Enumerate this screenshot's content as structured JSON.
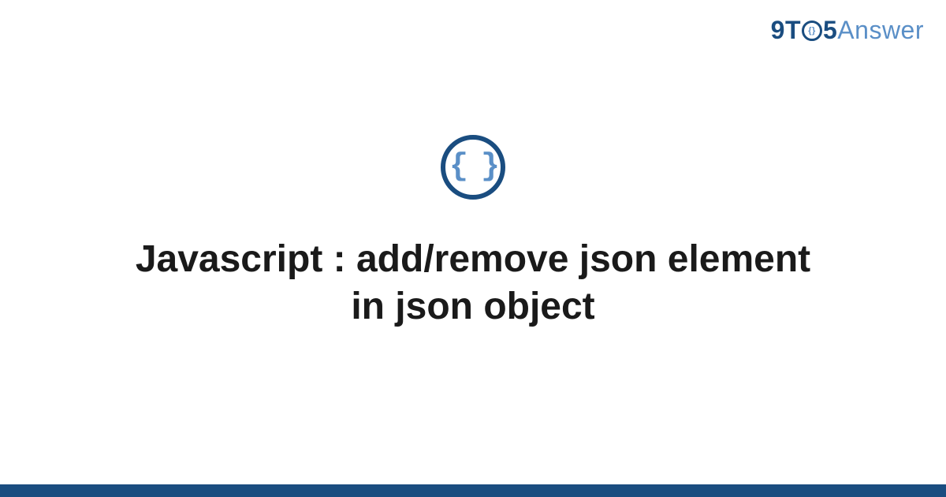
{
  "logo": {
    "part1": "9",
    "part2": "T",
    "part_o_inner": "{}",
    "part3": "5",
    "part4": "Answer"
  },
  "icon": {
    "name": "json-braces-icon",
    "glyph": "{ }"
  },
  "title": "Javascript : add/remove json element in json object",
  "colors": {
    "brand_dark": "#1a4d80",
    "brand_light": "#5a8fc7"
  }
}
